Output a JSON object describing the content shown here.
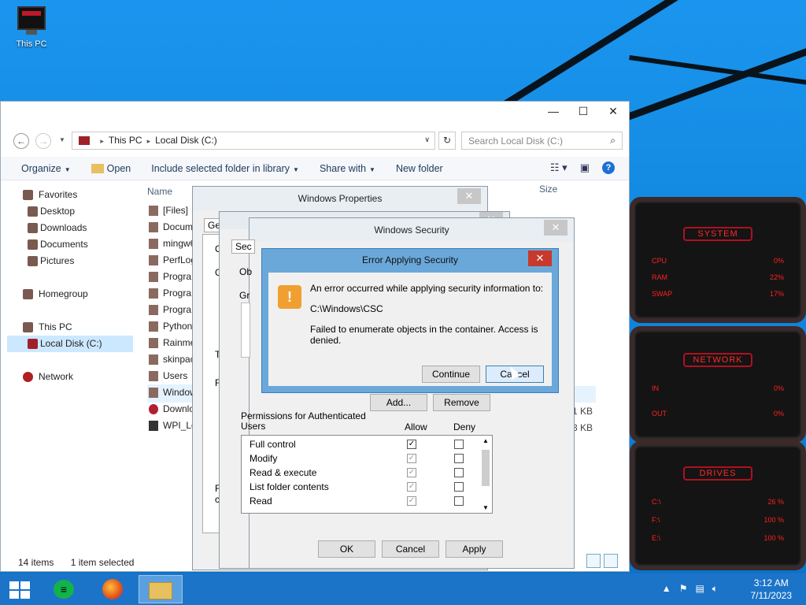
{
  "desktop": {
    "icon_label": "This PC"
  },
  "explorer": {
    "address": {
      "crumb1": "This PC",
      "crumb2": "Local Disk (C:)"
    },
    "search_placeholder": "Search Local Disk (C:)",
    "toolbar": {
      "organize": "Organize",
      "open": "Open",
      "include": "Include selected folder in library",
      "share": "Share with",
      "new_folder": "New folder"
    },
    "nav": {
      "favorites": "Favorites",
      "desktop": "Desktop",
      "downloads": "Downloads",
      "documents": "Documents",
      "pictures": "Pictures",
      "homegroup": "Homegroup",
      "thispc": "This PC",
      "localdisk": "Local Disk (C:)",
      "network": "Network"
    },
    "columns": {
      "name": "Name",
      "size": "Size"
    },
    "files": [
      "[Files]",
      "Docum",
      "mingw6",
      "PerfLog",
      "Progra",
      "Progra",
      "Progra",
      "Python",
      "Rainme",
      "skinpac",
      "Users",
      "Window",
      "Downlo",
      "WPI_Lo"
    ],
    "sizes": [
      "1 KB",
      "13 KB"
    ],
    "status": {
      "count": "14 items",
      "selected": "1 item selected"
    }
  },
  "props_dialog": {
    "title": "Windows Properties",
    "tab_partial": "Ge",
    "side_letters": [
      "C",
      "G",
      "T",
      "F",
      "F",
      "c"
    ]
  },
  "security_dialog": {
    "title": "Windows Security",
    "tab_partial": "Sec",
    "ob_partial": "Ob",
    "gr_partial": "Gr",
    "add_button": "Add...",
    "remove_button": "Remove",
    "permissions_label": "Permissions for Authenticated",
    "permissions_label2": "Users",
    "allow_header": "Allow",
    "deny_header": "Deny",
    "permissions": [
      {
        "name": "Full control",
        "allow": true,
        "allow_grey": false
      },
      {
        "name": "Modify",
        "allow": true,
        "allow_grey": true
      },
      {
        "name": "Read & execute",
        "allow": true,
        "allow_grey": true
      },
      {
        "name": "List folder contents",
        "allow": true,
        "allow_grey": true
      },
      {
        "name": "Read",
        "allow": true,
        "allow_grey": true
      }
    ],
    "ok_button": "OK",
    "cancel_button": "Cancel",
    "apply_button": "Apply"
  },
  "error_dialog": {
    "title": "Error Applying Security",
    "line1": "An error occurred while applying security information to:",
    "path": "C:\\Windows\\CSC",
    "line2": "Failed to enumerate objects in the container. Access is denied.",
    "continue_button": "Continue",
    "cancel_button": "Cancel"
  },
  "gadgets": {
    "system": {
      "title": "SYSTEM",
      "cpu": "CPU",
      "cpu_v": "0%",
      "ram": "RAM",
      "ram_v": "22%",
      "swap": "SWAP",
      "swap_v": "17%"
    },
    "network": {
      "title": "NETWORK",
      "in": "IN",
      "in_v": "0%",
      "out": "OUT",
      "out_v": "0%"
    },
    "drives": {
      "title": "DRIVES",
      "c": "C:\\",
      "c_v": "26 %",
      "f": "F:\\",
      "f_v": "100 %",
      "e": "E:\\",
      "e_v": "100 %"
    }
  },
  "taskbar": {
    "time": "3:12 AM",
    "date": "7/11/2023"
  }
}
